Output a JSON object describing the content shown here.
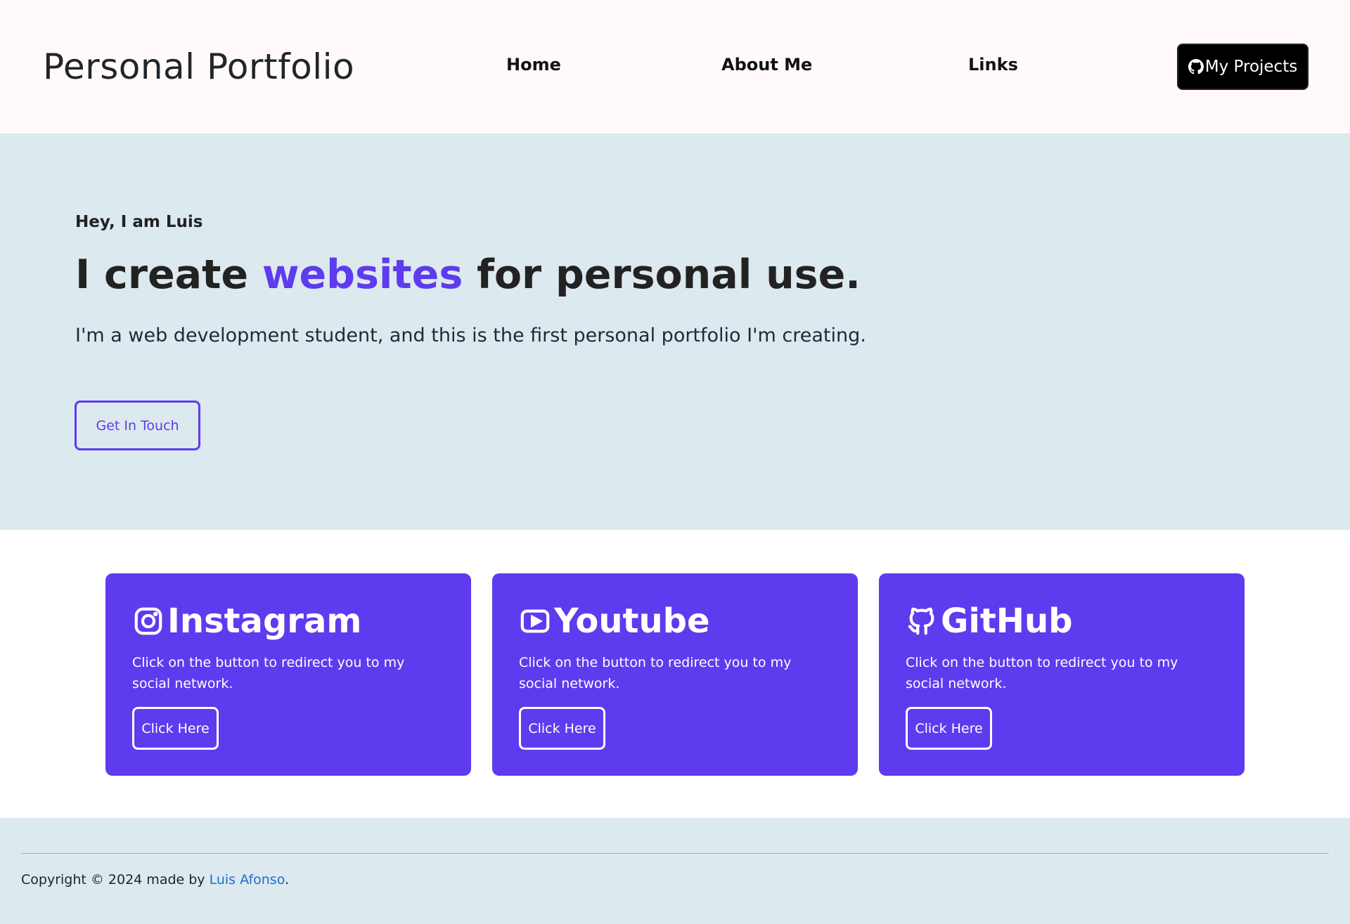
{
  "header": {
    "brand": "Personal Portfolio",
    "nav": [
      {
        "label": "Home"
      },
      {
        "label": "About Me"
      },
      {
        "label": "Links"
      }
    ],
    "projects_button": {
      "label": "My Projects",
      "icon": "github-icon"
    }
  },
  "hero": {
    "greeting": "Hey, I am Luis",
    "headline_prefix": "I create ",
    "headline_accent": "websites",
    "headline_suffix": " for personal use.",
    "description": "I'm a web development student, and this is the first personal portfolio I'm creating.",
    "cta_label": "Get In Touch"
  },
  "cards": [
    {
      "title": "Instagram",
      "icon": "instagram-icon",
      "description": "Click on the button to redirect you to my social network.",
      "button": "Click Here"
    },
    {
      "title": "Youtube",
      "icon": "youtube-icon",
      "description": "Click on the button to redirect you to my social network.",
      "button": "Click Here"
    },
    {
      "title": "GitHub",
      "icon": "github-icon",
      "description": "Click on the button to redirect you to my social network.",
      "button": "Click Here"
    }
  ],
  "footer": {
    "copyright_prefix": "Copyright © 2024 made by ",
    "author": "Luis Afonso",
    "suffix": "."
  },
  "colors": {
    "accent": "#5e3bee",
    "header_bg": "#fffaf9",
    "hero_bg": "#dce9ee",
    "link": "#1a6fd1"
  }
}
